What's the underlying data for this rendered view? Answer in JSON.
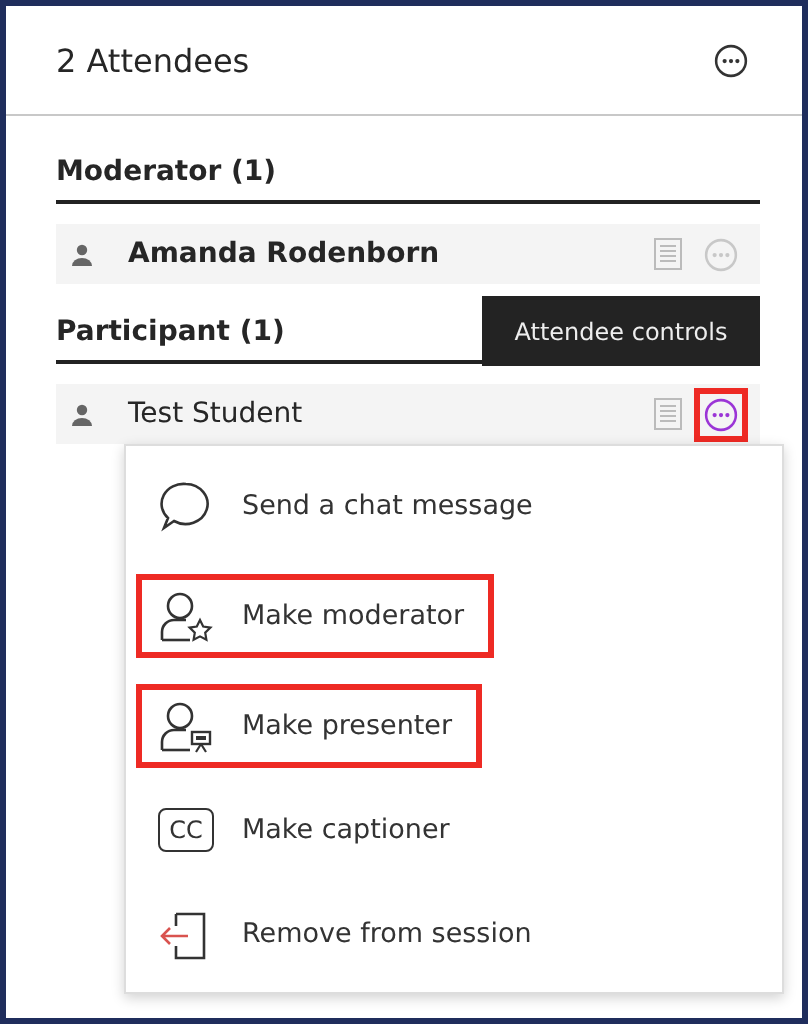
{
  "panel": {
    "title": "2 Attendees"
  },
  "groups": [
    {
      "heading": "Moderator (1)",
      "attendees": [
        {
          "name": "Amanda Rodenborn",
          "bold": true,
          "controls_active": false,
          "controls_annotated": false
        }
      ]
    },
    {
      "heading": "Participant (1)",
      "attendees": [
        {
          "name": "Test Student",
          "bold": false,
          "controls_active": true,
          "controls_annotated": true
        }
      ]
    }
  ],
  "tooltip": {
    "text": "Attendee controls"
  },
  "menu": {
    "items": [
      {
        "kind": "chat",
        "label": "Send a chat message",
        "annotated": false
      },
      {
        "kind": "moderator",
        "label": "Make moderator",
        "annotated": true
      },
      {
        "kind": "presenter",
        "label": "Make presenter",
        "annotated": true
      },
      {
        "kind": "captioner",
        "label": "Make captioner",
        "icon_text": "CC",
        "annotated": false
      },
      {
        "kind": "remove",
        "label": "Remove from session",
        "annotated": false
      }
    ]
  }
}
